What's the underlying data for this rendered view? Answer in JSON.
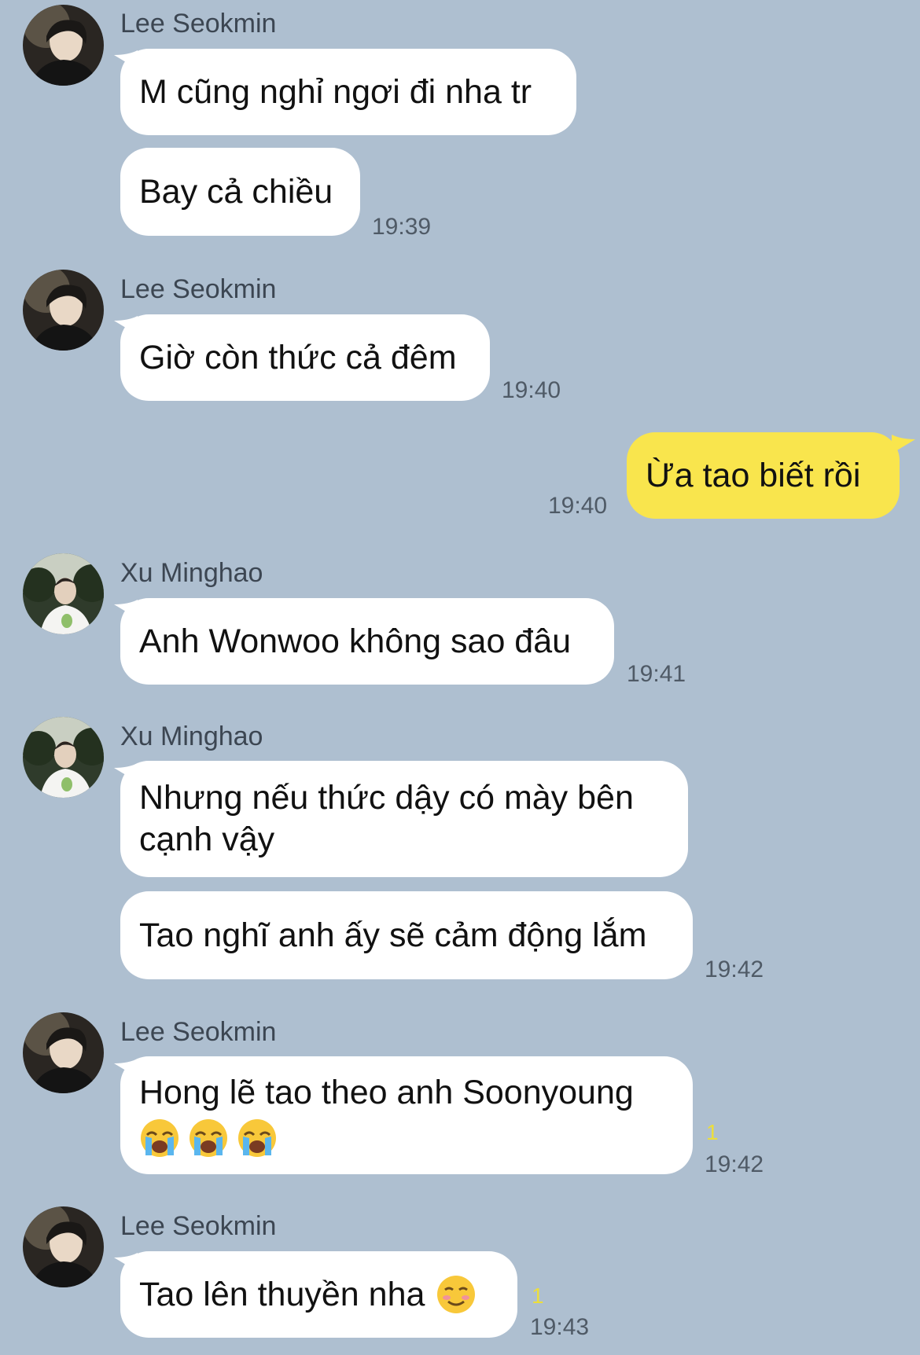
{
  "colors": {
    "background": "#aebfd0",
    "incoming_bubble": "#ffffff",
    "outgoing_bubble": "#f9e54d",
    "unread_badge": "#ecde3c"
  },
  "messages": [
    {
      "sender": "Lee Seokmin",
      "avatar_icon": "avatar-lee-seokmin",
      "bubbles": [
        "M cũng nghỉ ngơi đi nha tr",
        "Bay cả chiều"
      ],
      "time": "19:39"
    },
    {
      "sender": "Lee Seokmin",
      "avatar_icon": "avatar-lee-seokmin",
      "bubbles": [
        "Giờ còn thức cả đêm"
      ],
      "time": "19:40"
    },
    {
      "outgoing": true,
      "bubbles": [
        "Ừa tao biết rồi"
      ],
      "time": "19:40"
    },
    {
      "sender": "Xu Minghao",
      "avatar_icon": "avatar-xu-minghao",
      "bubbles": [
        "Anh Wonwoo không sao đâu"
      ],
      "time": "19:41"
    },
    {
      "sender": "Xu Minghao",
      "avatar_icon": "avatar-xu-minghao",
      "bubbles": [
        "Nhưng nếu thức dậy có mày bên",
        "cạnh vậy",
        "Tao nghĩ anh ấy sẽ cảm động lắm"
      ],
      "time": "19:42"
    },
    {
      "sender": "Lee Seokmin",
      "avatar_icon": "avatar-lee-seokmin",
      "bubbles": [
        "Hong lẽ tao theo anh Soonyoung"
      ],
      "emojis": [
        "loudly-crying-face-icon",
        "loudly-crying-face-icon",
        "loudly-crying-face-icon"
      ],
      "unread": "1",
      "time": "19:42"
    },
    {
      "sender": "Lee Seokmin",
      "avatar_icon": "avatar-lee-seokmin",
      "bubbles": [
        "Tao lên thuyền nha"
      ],
      "emojis": [
        "smiling-face-icon"
      ],
      "unread": "1",
      "time": "19:43"
    }
  ]
}
